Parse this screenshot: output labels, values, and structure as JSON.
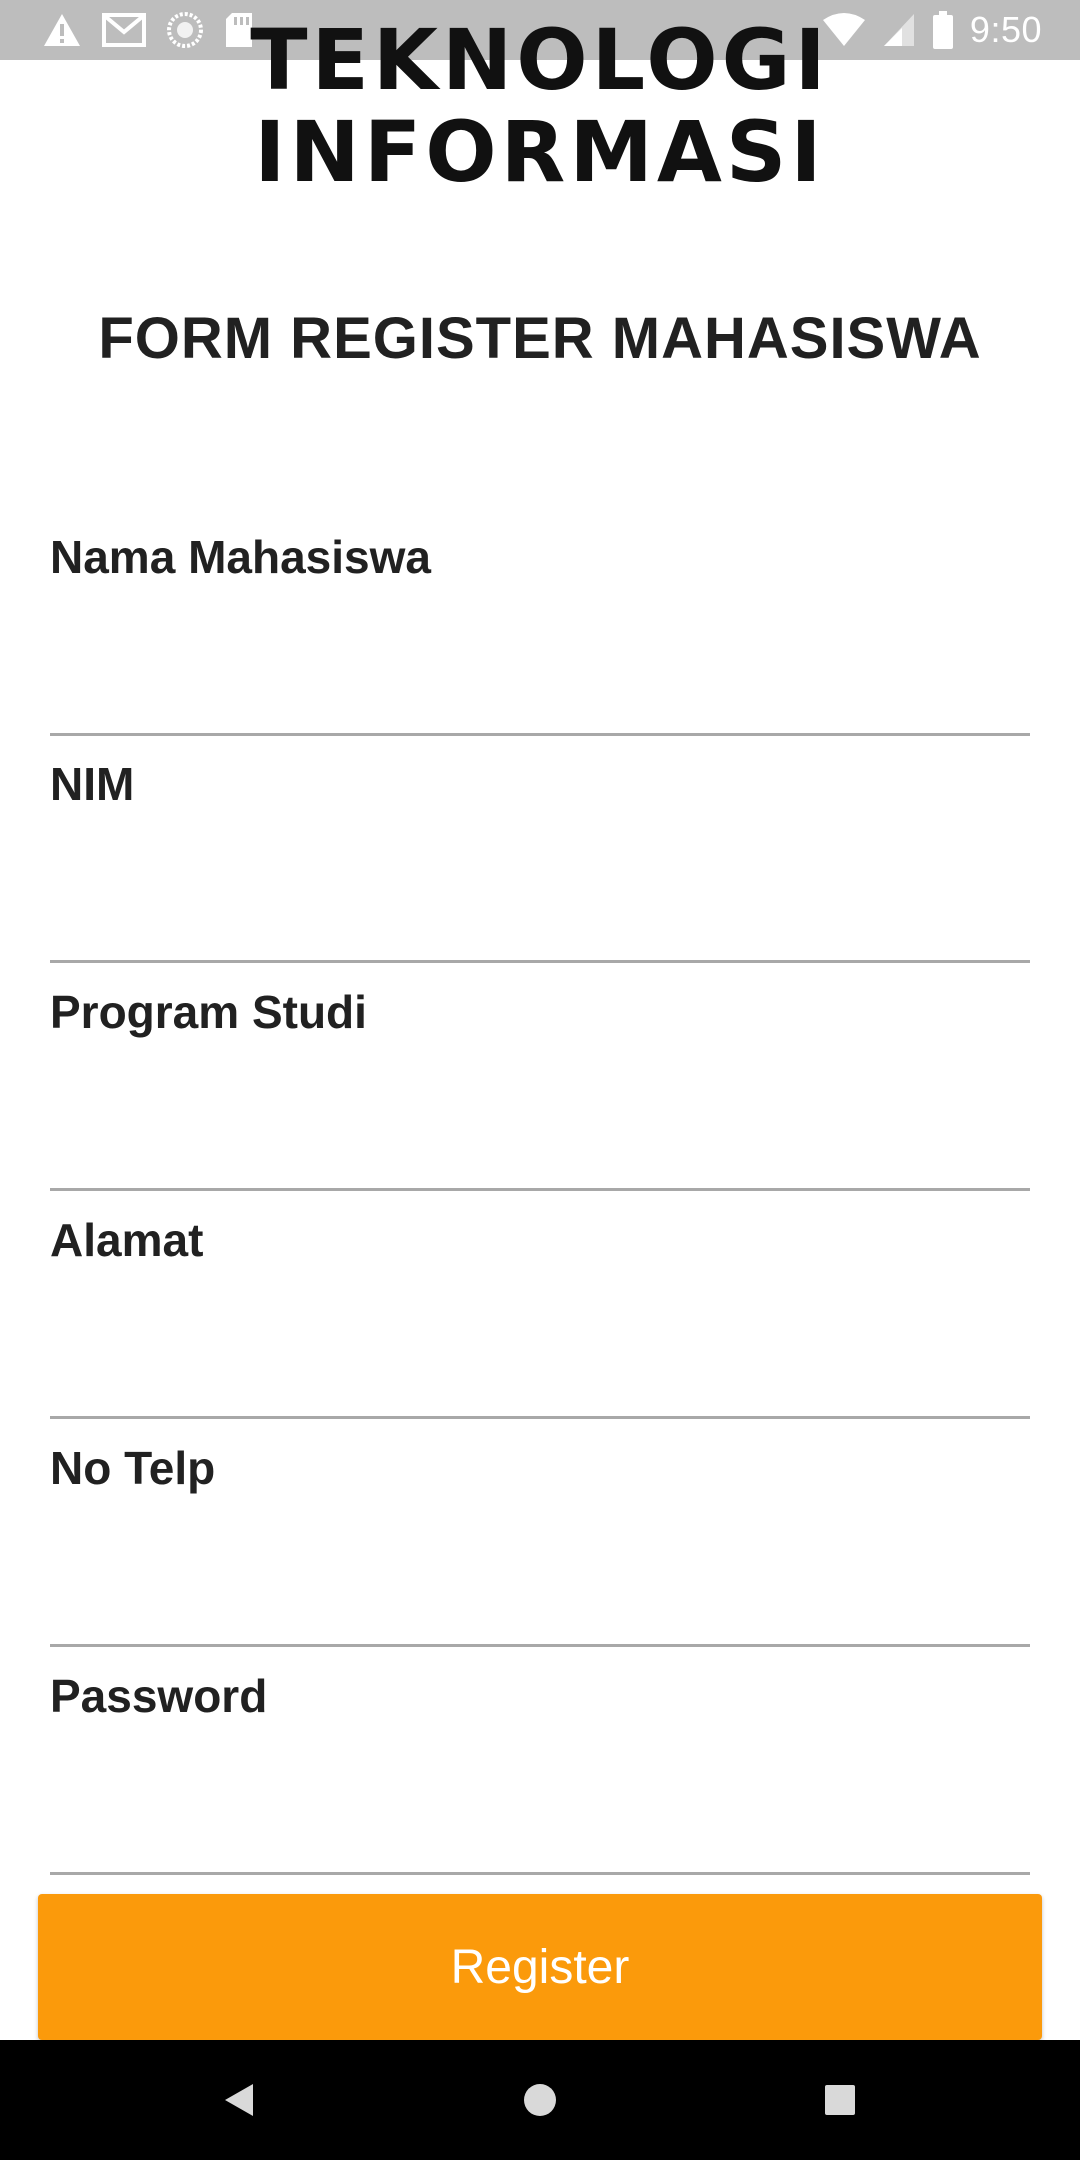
{
  "status_bar": {
    "time": "9:50",
    "left_icons": [
      "warning-icon",
      "gmail-icon",
      "sync-icon",
      "sd-card-icon"
    ],
    "right_icons": [
      "wifi-icon",
      "signal-icon",
      "battery-icon"
    ]
  },
  "logo": {
    "line1": "TEKNOLOGI",
    "line2": "INFORMASI"
  },
  "form": {
    "title": "FORM REGISTER MAHASISWA",
    "fields": [
      {
        "label": "Nama Mahasiswa",
        "value": ""
      },
      {
        "label": "NIM",
        "value": ""
      },
      {
        "label": "Program Studi",
        "value": ""
      },
      {
        "label": "Alamat",
        "value": ""
      },
      {
        "label": "No Telp",
        "value": ""
      },
      {
        "label": "Password",
        "value": ""
      }
    ],
    "submit_label": "Register"
  },
  "colors": {
    "accent": "#fb9a0b",
    "status_bar": "#bdbdbd",
    "nav_bar": "#000000",
    "divider": "#a8a8a8"
  },
  "nav_bar": {
    "icons": [
      "back-icon",
      "home-icon",
      "recents-icon"
    ]
  }
}
